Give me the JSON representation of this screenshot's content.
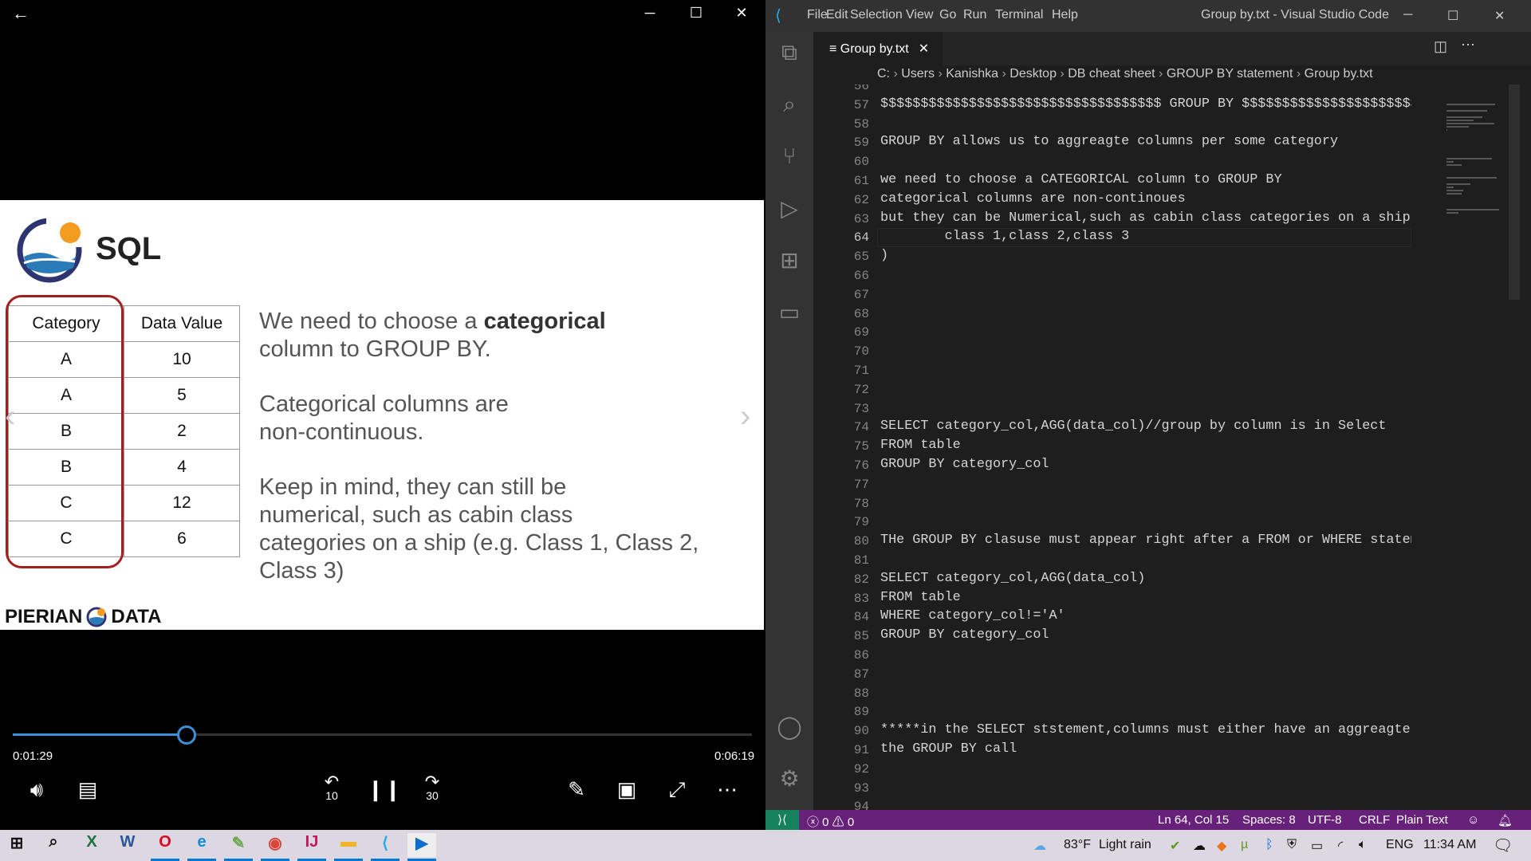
{
  "player": {
    "slide": {
      "logo_text": "SQL",
      "table": {
        "headers": [
          "Category",
          "Data Value"
        ],
        "rows": [
          [
            "A",
            "10"
          ],
          [
            "A",
            "5"
          ],
          [
            "B",
            "2"
          ],
          [
            "B",
            "4"
          ],
          [
            "C",
            "12"
          ],
          [
            "C",
            "6"
          ]
        ]
      },
      "para1_a": "We need to choose a ",
      "para1_bold": "categorical",
      "para1_b": "column to GROUP BY.",
      "para2_l1": "Categorical columns are",
      "para2_l2": "non-continuous.",
      "para3_l1": "Keep in mind, they can still be",
      "para3_l2": "numerical, such as cabin class",
      "para3_l3": "categories on a ship (e.g. Class 1, Class 2,",
      "para3_l4": "Class 3)",
      "brand_left": "PIERIAN",
      "brand_right": "DATA"
    },
    "current_time": "0:01:29",
    "total_time": "0:06:19",
    "progress_fraction": 0.235,
    "skip_back": "10",
    "skip_forward": "30"
  },
  "vscode": {
    "menu": [
      "File",
      "Edit",
      "Selection",
      "View",
      "Go",
      "Run",
      "Terminal",
      "Help"
    ],
    "title": "Group by.txt - Visual Studio Code",
    "tab": "Group by.txt",
    "breadcrumbs": [
      "C:",
      "Users",
      "Kanishka",
      "Desktop",
      "DB cheat sheet",
      "GROUP BY statement",
      "Group by.txt"
    ],
    "first_line": 56,
    "current_line": 64,
    "lines": [
      "",
      "$$$$$$$$$$$$$$$$$$$$$$$$$$$$$$$$$$$ GROUP BY $$$$$$$$$$$$$$$$$$$$$$$",
      "",
      "GROUP BY allows us to aggreagte columns per some category",
      "",
      "we need to choose a CATEGORICAL column to GROUP BY",
      "categorical columns are non-continoues",
      "but they can be Numerical,such as cabin class categories on a ship(",
      "        class 1,class 2,class 3",
      ")",
      "",
      "",
      "",
      "",
      "",
      "",
      "",
      "",
      "SELECT category_col,AGG(data_col)//group by column is in Select",
      "FROM table",
      "GROUP BY category_col",
      "",
      "",
      "",
      "THe GROUP BY clasuse must appear right after a FROM or WHERE statement",
      "",
      "SELECT category_col,AGG(data_col)",
      "FROM table",
      "WHERE category_col!='A'",
      "GROUP BY category_col",
      "",
      "",
      "",
      "",
      "*****in the SELECT ststement,columns must either have an aggreagte functi",
      "the GROUP BY call",
      "",
      "",
      ""
    ],
    "status": {
      "errors": "0",
      "warnings": "0",
      "position": "Ln 64, Col 15",
      "spaces": "Spaces: 8",
      "encoding": "UTF-8",
      "eol": "CRLF",
      "language": "Plain Text"
    }
  },
  "taskbar": {
    "apps": [
      "windows-start",
      "search",
      "excel",
      "word",
      "opera",
      "edge",
      "notepad-plus",
      "chrome",
      "intellij",
      "file-explorer",
      "vscode",
      "movies-tv"
    ],
    "weather": "83°F",
    "weather_desc": "Light rain",
    "language": "ENG",
    "time": "11:34 AM"
  },
  "colors": {
    "accent": "#3a8fd8",
    "statusbar": "#68217a",
    "highlight_box": "#a31f1f"
  }
}
